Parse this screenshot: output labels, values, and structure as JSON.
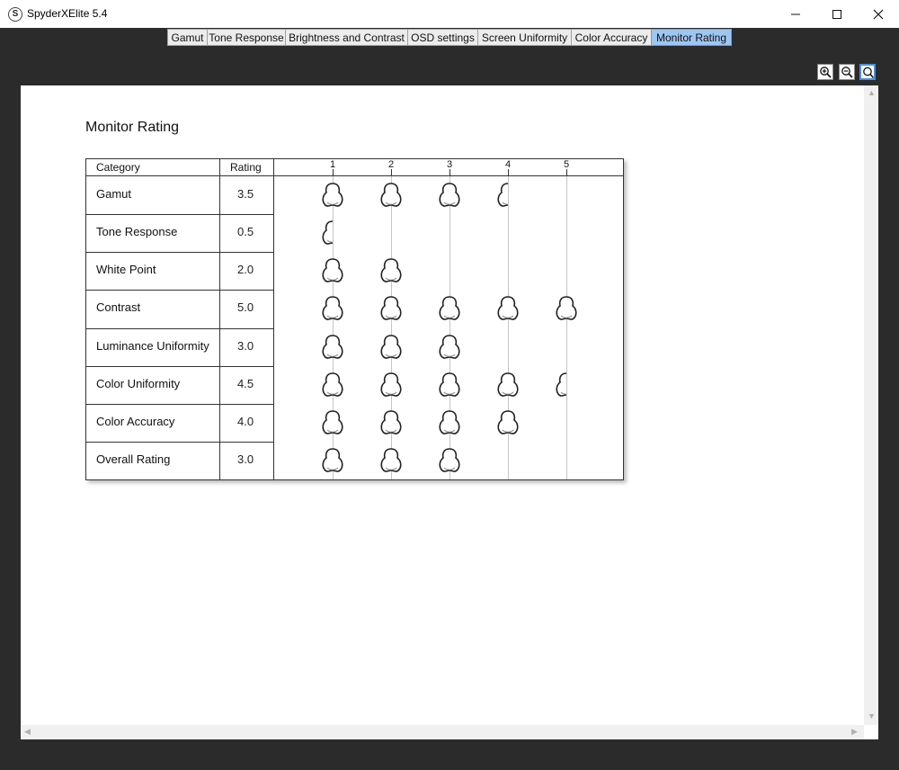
{
  "window": {
    "title": "SpyderXElite 5.4",
    "app_icon_letter": "S"
  },
  "tabs": [
    {
      "label": "Gamut",
      "active": false
    },
    {
      "label": "Tone Response",
      "active": false
    },
    {
      "label": "Brightness and Contrast",
      "active": false
    },
    {
      "label": "OSD settings",
      "active": false
    },
    {
      "label": "Screen Uniformity",
      "active": false
    },
    {
      "label": "Color Accuracy",
      "active": false
    },
    {
      "label": "Monitor Rating",
      "active": true
    }
  ],
  "zoom_controls": [
    "zoom-in-icon",
    "zoom-out-icon",
    "zoom-fit-icon"
  ],
  "report": {
    "title": "Monitor Rating",
    "headers": {
      "category": "Category",
      "rating": "Rating",
      "scale": [
        "1",
        "2",
        "3",
        "4",
        "5"
      ]
    },
    "rows": [
      {
        "category": "Gamut",
        "rating": "3.5",
        "value": 3.5
      },
      {
        "category": "Tone Response",
        "rating": "0.5",
        "value": 0.5
      },
      {
        "category": "White Point",
        "rating": "2.0",
        "value": 2.0
      },
      {
        "category": "Contrast",
        "rating": "5.0",
        "value": 5.0
      },
      {
        "category": "Luminance Uniformity",
        "rating": "3.0",
        "value": 3.0
      },
      {
        "category": "Color Uniformity",
        "rating": "4.5",
        "value": 4.5
      },
      {
        "category": "Color Accuracy",
        "rating": "4.0",
        "value": 4.0
      },
      {
        "category": "Overall Rating",
        "rating": "3.0",
        "value": 3.0
      }
    ]
  }
}
